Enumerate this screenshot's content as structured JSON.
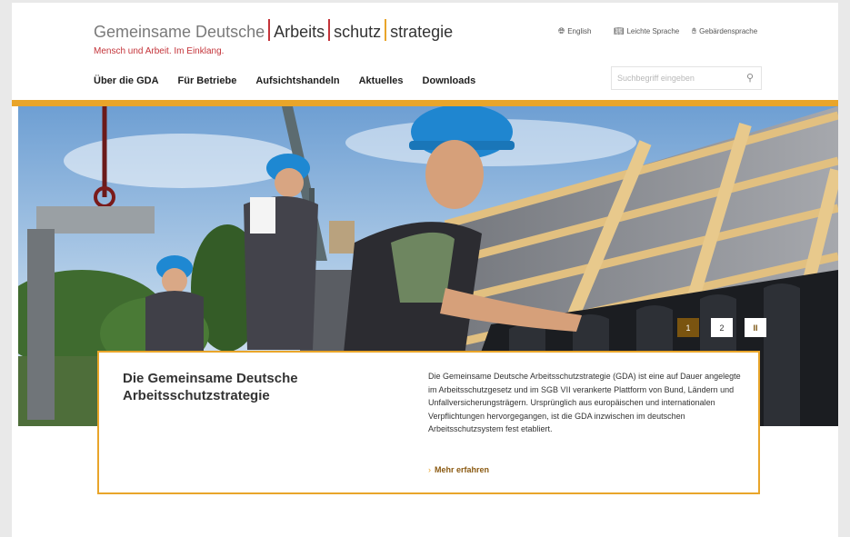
{
  "header": {
    "logo": {
      "part1": "Gemeinsame Deutsche",
      "part2": "Arbeits",
      "part3": "schutz",
      "part4": "strategie",
      "tagline": "Mensch und Arbeit. Im Einklang."
    },
    "utility": {
      "english": "English",
      "easy_language": "Leichte Sprache",
      "sign_language": "Gebärdensprache"
    },
    "nav": [
      {
        "label": "Über die GDA"
      },
      {
        "label": "Für Betriebe"
      },
      {
        "label": "Aufsichtshandeln"
      },
      {
        "label": "Aktuelles"
      },
      {
        "label": "Downloads"
      }
    ],
    "search": {
      "placeholder": "Suchbegriff eingeben"
    }
  },
  "hero": {
    "slides": [
      "1",
      "2"
    ],
    "pause": "II"
  },
  "card": {
    "title": "Die Gemeinsame Deutsche Arbeitsschutzstrategie",
    "text": "Die Gemeinsame Deutsche Arbeitsschutzstrategie (GDA) ist eine auf Dauer angelegte im Arbeitsschutzgesetz und im SGB VII verankerte Plattform von Bund, Ländern und Unfallversicherungs­trägern. Ursprünglich aus europäischen und internationalen Verpflichtungen hervorgegangen, ist die GDA inzwischen im deutschen Arbeitsschutzsystem fest etabliert.",
    "link": "Mehr erfahren"
  },
  "colors": {
    "accent": "#e9a52a",
    "brand_red": "#c4343a",
    "link_brown": "#8b5a12"
  },
  "icons": {
    "english": "globe-icon",
    "easy_language": "book-icon",
    "sign_language": "hand-icon",
    "search": "search-icon",
    "link": "chevron-right-icon"
  }
}
